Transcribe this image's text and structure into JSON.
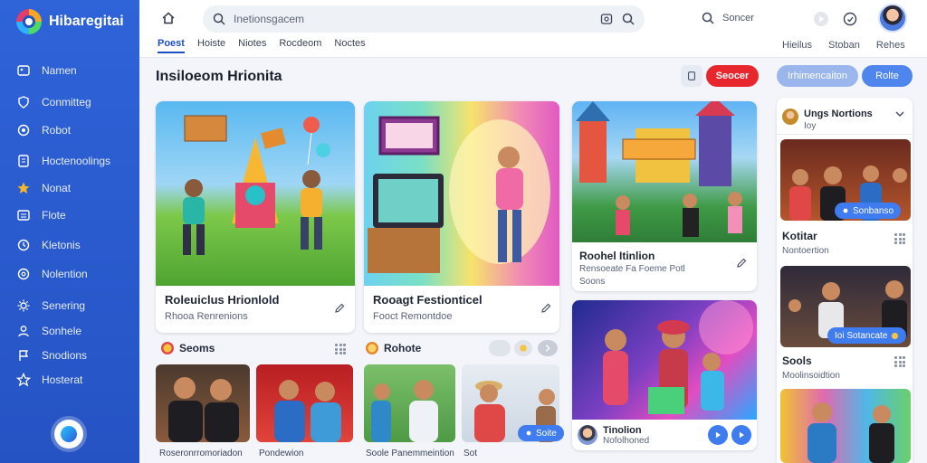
{
  "app": {
    "name": "Hibaregitai"
  },
  "sidebar": {
    "items": [
      {
        "label": "Namen",
        "icon": "image-icon"
      },
      {
        "label": "Conmitteg",
        "icon": "shield-icon"
      },
      {
        "label": "Robot",
        "icon": "target-icon"
      },
      {
        "label": "Hoctenoolings",
        "icon": "document-icon"
      },
      {
        "label": "Nonat",
        "icon": "star-icon"
      },
      {
        "label": "Flote",
        "icon": "list-icon"
      },
      {
        "label": "Kletonis",
        "icon": "clock-icon"
      },
      {
        "label": "Nolention",
        "icon": "settings-icon"
      },
      {
        "label": "Senering",
        "icon": "gear-icon"
      },
      {
        "label": "Sonhele",
        "icon": "user-icon"
      },
      {
        "label": "Snodions",
        "icon": "flag-icon"
      },
      {
        "label": "Hosterat",
        "icon": "star-outline-icon"
      }
    ]
  },
  "topbar": {
    "search_placeholder": "Inetionsgacem",
    "right_search_label": "Soncer",
    "tabs": [
      "Poest",
      "Hoiste",
      "Niotes",
      "Rocdeom",
      "Noctes"
    ],
    "right_tabs": [
      "Hieilus",
      "Stoban",
      "Rehes"
    ]
  },
  "main": {
    "title": "Insiloeom Hrionita",
    "buttons": {
      "primary": "Seocer",
      "secondary": "Irhimencaiton",
      "tertiary": "Rolte"
    }
  },
  "cards": {
    "card1": {
      "title": "Roleuiclus Hrionlold",
      "sub": "Rhooa Renrenions"
    },
    "card2": {
      "title": "Rooagt Festionticel",
      "sub": "Fooct Remontdoe"
    },
    "card3": {
      "title": "Roohel Itinlion",
      "sub1": "Rensoeate Fa Foeme Potl",
      "sub2": "Soons"
    },
    "card4": {
      "title": "Tinolion",
      "sub": "Nofolhoned"
    }
  },
  "sections": {
    "left": {
      "label": "Seoms",
      "captions": [
        "Roseronrromoriadon",
        "Pondewion"
      ]
    },
    "middle": {
      "label": "Rohote",
      "captions": [
        "Soole Panemmeintion",
        "Sot"
      ],
      "pill": "Soite"
    }
  },
  "right_panel": {
    "header_title": "Ungs Nortions",
    "header_sub": "Ioy",
    "items": [
      {
        "title": "Kotitar",
        "sub": "Nontoertion",
        "pill": "Sonbanso"
      },
      {
        "title": "Sools",
        "sub": "Moolinsoidtion",
        "pill": "Ioi Sotancate"
      }
    ]
  },
  "colors": {
    "sidebar": "#2553c4",
    "accent": "#3f7cf0",
    "danger": "#e8262e"
  }
}
